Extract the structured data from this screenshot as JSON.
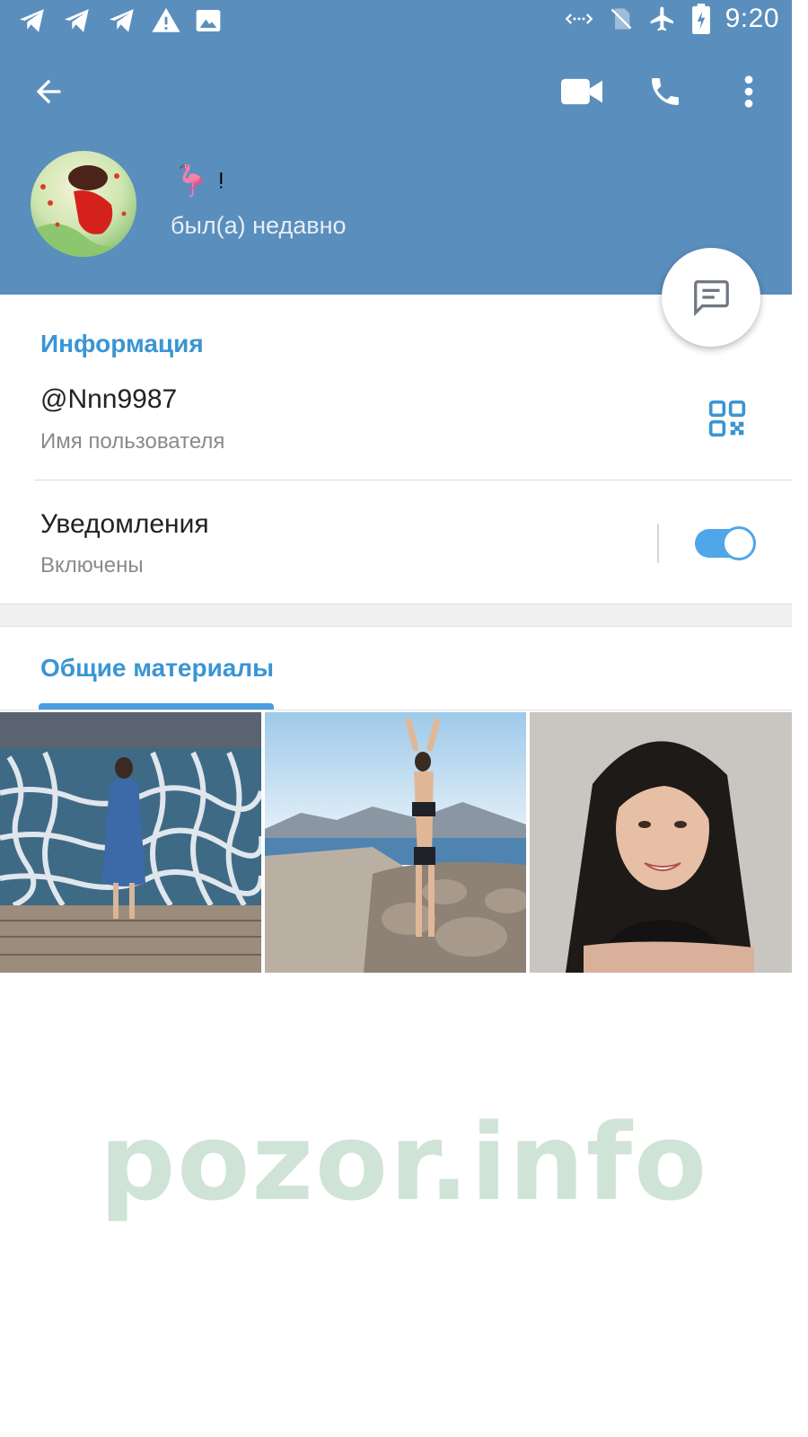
{
  "status_bar": {
    "time": "9:20",
    "left_icons": [
      "telegram-icon",
      "telegram-icon",
      "telegram-icon",
      "warning-icon",
      "image-icon"
    ],
    "right_icons": [
      "data-saver-icon",
      "no-sim-icon",
      "airplane-icon",
      "battery-charging-icon"
    ]
  },
  "toolbar": {
    "back_icon": "arrow-left-icon",
    "actions": [
      "video-call-icon",
      "phone-icon",
      "more-vert-icon"
    ]
  },
  "profile": {
    "name": "🦩 ᵎ",
    "status": "был(а) недавно"
  },
  "info": {
    "title": "Информация",
    "username": "@Nnn9987",
    "username_label": "Имя пользователя",
    "notifications": "Уведомления",
    "notifications_state": "Включены",
    "notifications_on": true
  },
  "shared": {
    "tab_title": "Общие материалы"
  },
  "watermark": "pozor.info",
  "colors": {
    "header": "#5a8ebd",
    "accent": "#3a95d4",
    "toggle": "#4fa6e8"
  }
}
